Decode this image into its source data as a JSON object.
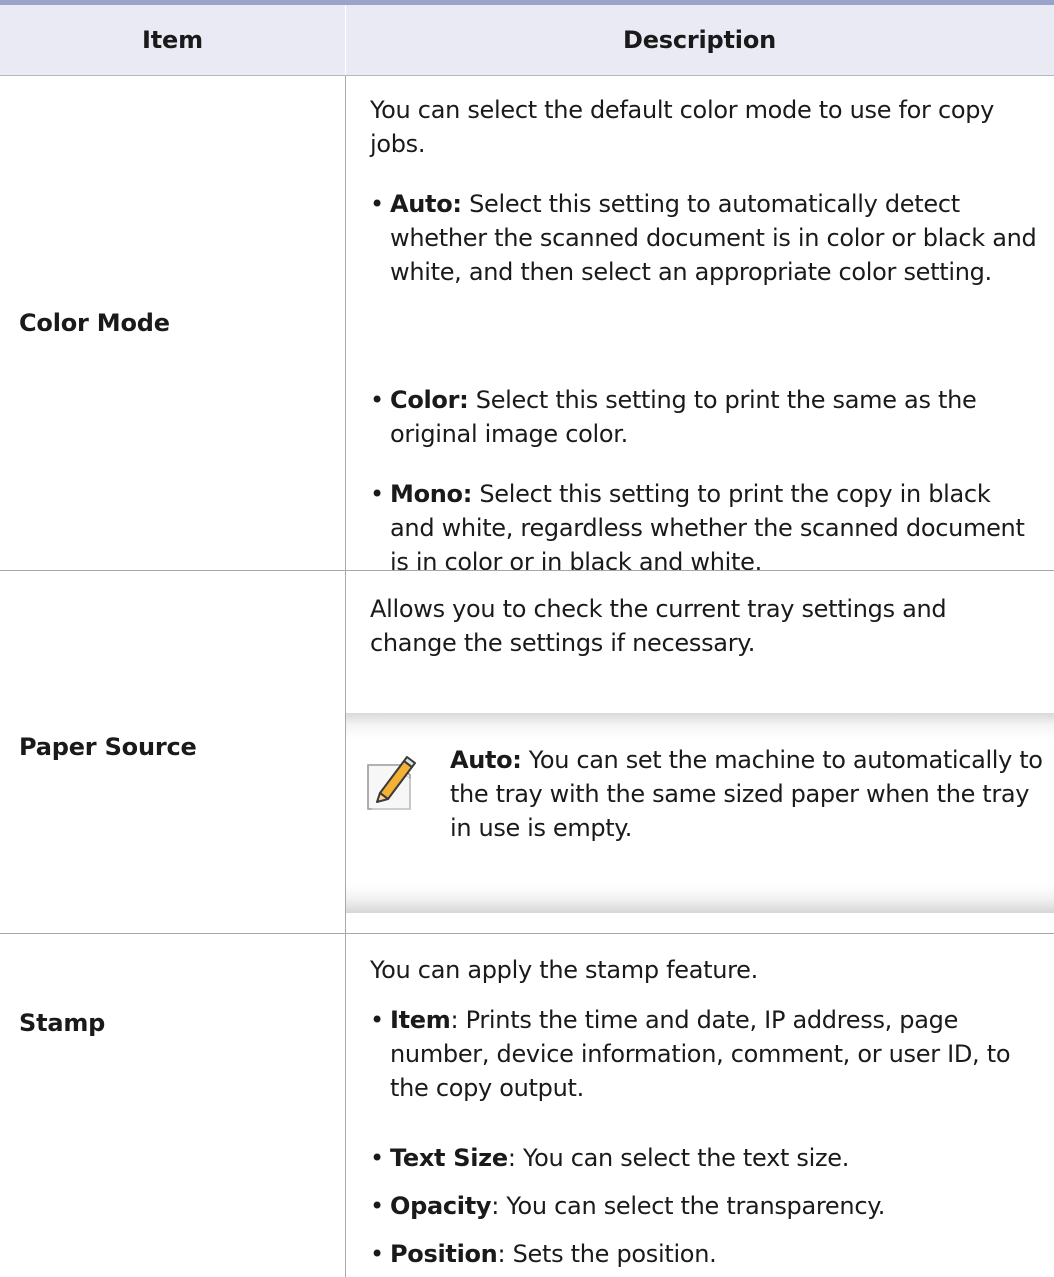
{
  "table": {
    "header": {
      "item": "Item",
      "description": "Description"
    },
    "rows": [
      {
        "item": "Color Mode",
        "intro": "You can select the default color mode to use for copy jobs.",
        "bullets": [
          {
            "bold": "Auto:",
            "text": " Select this setting to automatically detect whether the scanned document is in color or black and white, and then select an appropriate color setting."
          },
          {
            "bold": "Color:",
            "text": " Select this setting to print the same as the original image color."
          },
          {
            "bold": "Mono:",
            "text": " Select this setting to print the copy in black and white, regardless whether the scanned document is in color or in black and white."
          }
        ]
      },
      {
        "item": "Paper Source",
        "intro": "Allows you to check the current tray settings and change the settings if necessary.",
        "note": {
          "icon": "note-pencil-icon",
          "bold": "Auto:",
          "text": " You can set the machine to automatically to the tray with the same sized paper when the tray in use is empty."
        }
      },
      {
        "item": "Stamp",
        "intro": "You can apply the stamp feature.",
        "bullets": [
          {
            "bold": "Item",
            "text": ": Prints the time and date, IP address, page number, device information, comment, or user ID, to the copy output."
          },
          {
            "bold": "Text Size",
            "text": ": You can select the text size."
          },
          {
            "bold": "Opacity",
            "text": ": You can select the transparency."
          },
          {
            "bold": "Position",
            "text": ": Sets the position."
          }
        ]
      }
    ]
  }
}
